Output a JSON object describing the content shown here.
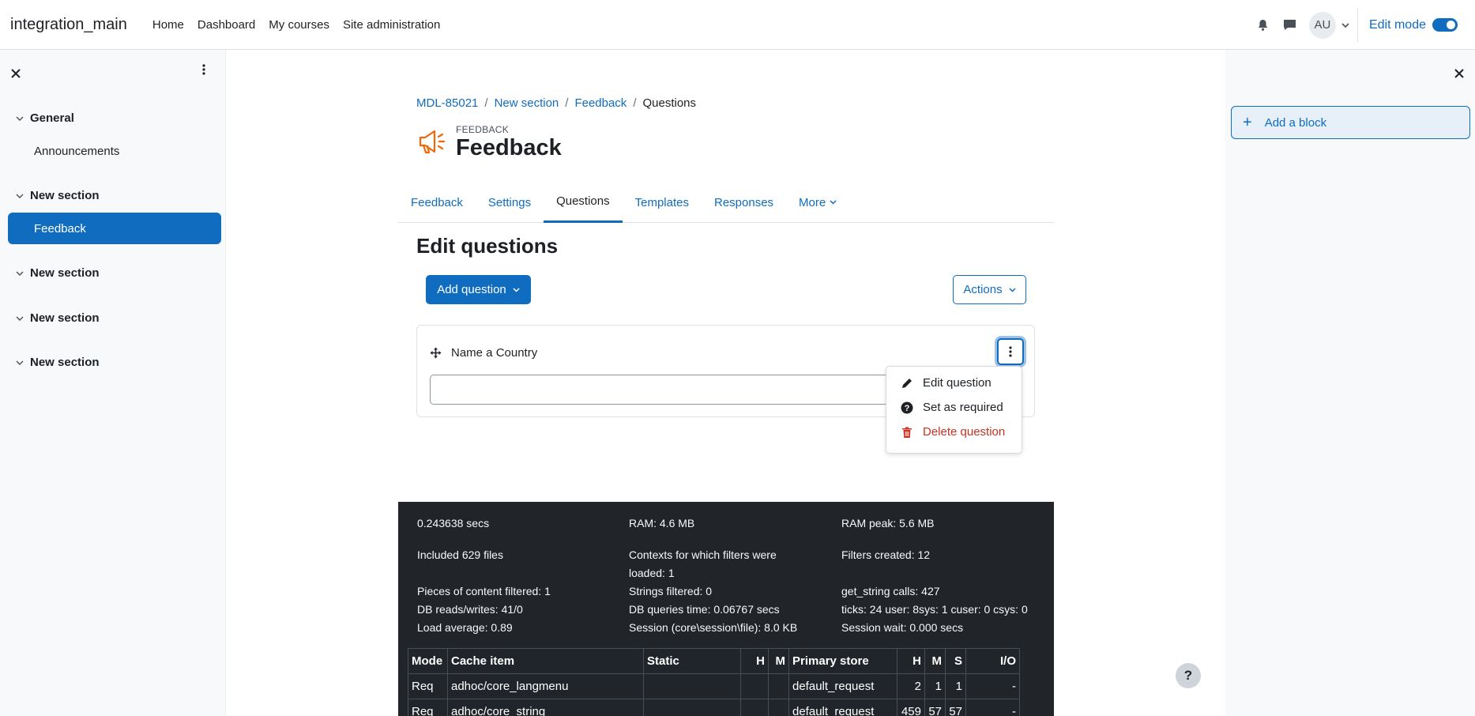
{
  "navbar": {
    "brand": "integration_main",
    "links": [
      "Home",
      "Dashboard",
      "My courses",
      "Site administration"
    ],
    "avatar_initials": "AU",
    "edit_mode_label": "Edit mode",
    "edit_mode_on": true
  },
  "course_index": {
    "sections": [
      {
        "title": "General",
        "items": [
          "Announcements"
        ]
      },
      {
        "title": "New section",
        "items": [
          "Feedback"
        ]
      },
      {
        "title": "New section",
        "items": []
      },
      {
        "title": "New section",
        "items": []
      },
      {
        "title": "New section",
        "items": []
      }
    ],
    "active_item": "Feedback"
  },
  "blocks": {
    "add_block_label": "Add a block"
  },
  "breadcrumb": [
    "MDL-85021",
    "New section",
    "Feedback",
    "Questions"
  ],
  "activity": {
    "kind": "FEEDBACK",
    "title": "Feedback"
  },
  "tabs": [
    {
      "label": "Feedback"
    },
    {
      "label": "Settings"
    },
    {
      "label": "Questions",
      "active": true
    },
    {
      "label": "Templates"
    },
    {
      "label": "Responses"
    },
    {
      "label": "More"
    }
  ],
  "main": {
    "heading": "Edit questions",
    "add_question_label": "Add question",
    "actions_label": "Actions",
    "question": {
      "name": "Name a Country",
      "answer_value": ""
    },
    "menu": [
      {
        "label": "Edit question",
        "icon": "pencil-icon"
      },
      {
        "label": "Set as required",
        "icon": "question-circle-icon"
      },
      {
        "label": "Delete question",
        "icon": "trash-icon",
        "danger": true
      }
    ]
  },
  "perf": {
    "time": "0.243638 secs",
    "ram": "RAM: 4.6 MB",
    "ram_peak": "RAM peak: 5.6 MB",
    "included": "Included 629 files",
    "contexts_line1": "Contexts for which filters were",
    "contexts_line2": "loaded: 1",
    "filters_created": "Filters created: 12",
    "pieces": "Pieces of content filtered: 1",
    "strings": "Strings filtered: 0",
    "get_string": "get_string calls: 427",
    "db_rw": "DB reads/writes: 41/0",
    "db_time": "DB queries time: 0.06767 secs",
    "ticks": "ticks: 24 user: 8sys: 1 cuser: 0 csys: 0",
    "load": "Load average: 0.89",
    "session": "Session (core\\session\\file): 8.0 KB",
    "session_wait": "Session wait: 0.000 secs",
    "cache_headers": [
      "Mode",
      "Cache item",
      "Static",
      "H",
      "M",
      "Primary store",
      "H",
      "M",
      "S",
      "I/O"
    ],
    "cache_rows": [
      [
        "Req",
        "adhoc/core_langmenu",
        "",
        "",
        "",
        "default_request",
        "2",
        "1",
        "1",
        "-"
      ],
      [
        "Req",
        "adhoc/core_string",
        "",
        "",
        "",
        "default_request",
        "459",
        "57",
        "57",
        "-"
      ]
    ]
  },
  "help_label": "?"
}
